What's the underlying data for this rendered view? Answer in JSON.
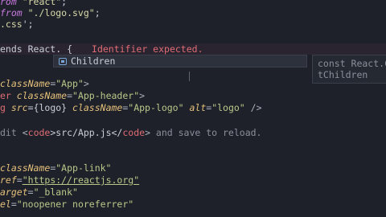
{
  "code": {
    "l1": {
      "a": "rom ",
      "b": "\"react\"",
      "c": ";"
    },
    "l2": {
      "a": "from ",
      "b": "\"./logo.svg\"",
      "c": ";"
    },
    "l3": {
      "a": ".css",
      "b": "';"
    },
    "l4": {
      "a": "ends React. {",
      "err": "Identifier expected."
    },
    "l5": {
      "a": "className",
      "b": "=",
      "c": "\"App\"",
      "d": ">"
    },
    "l6": {
      "a": "er ",
      "b": "className",
      "c": "=",
      "d": "\"App-header\"",
      "e": ">"
    },
    "l7": {
      "a": "g ",
      "b": "src",
      "c": "={logo} ",
      "d": "className",
      "e": "=",
      "f": "\"App-logo\"",
      "g": " ",
      "h": "alt",
      "i": "=",
      "j": "\"logo\"",
      "k": " />"
    },
    "l8": {
      "a": "dit ",
      "b": "<",
      "c": "code",
      "d": ">src/App.js</",
      "e": "code",
      "f": ">",
      "g": " and save to reload."
    },
    "l9": {
      "a": "className",
      "b": "=",
      "c": "\"App-link\""
    },
    "l10": {
      "a": "ref",
      "b": "=",
      "c": "\"https://reactjs.org\""
    },
    "l11": {
      "a": "arget",
      "b": "=",
      "c": "\"_blank\""
    },
    "l12": {
      "a": "el",
      "b": "=",
      "c": "\"noopener noreferrer\""
    }
  },
  "suggestion": {
    "icon": "symbol-field-icon",
    "label": "Children"
  },
  "detail": {
    "line1": "const React.C",
    "line2": "tChildren"
  },
  "colors": {
    "background": "#1e2129",
    "error": "#e06c75",
    "string": "#b9c98a"
  }
}
